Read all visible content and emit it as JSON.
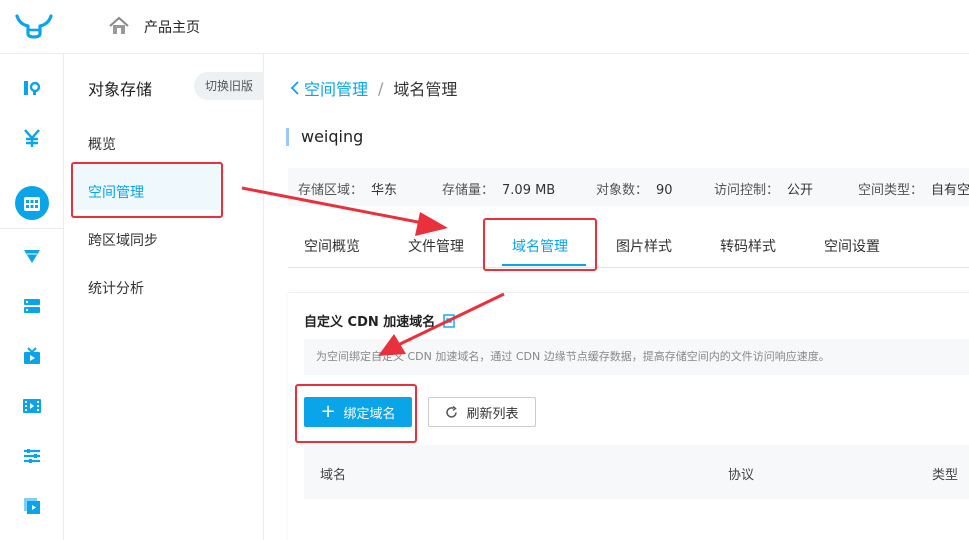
{
  "topbar": {
    "title": "产品主页"
  },
  "rail": {
    "items": [
      "stats-icon",
      "billing-icon",
      "storage-icon",
      "cdn-icon",
      "server-icon",
      "live-icon",
      "video-icon",
      "settings-icon",
      "media-icon"
    ]
  },
  "subnav": {
    "title": "对象存储",
    "switch_label": "切换旧版",
    "items": [
      {
        "label": "概览"
      },
      {
        "label": "空间管理"
      },
      {
        "label": "跨区域同步"
      },
      {
        "label": "统计分析"
      }
    ]
  },
  "breadcrumb": {
    "parent": "空间管理",
    "sep": "/",
    "current": "域名管理"
  },
  "bucket": {
    "name": "weiqing"
  },
  "info": {
    "region_label": "存储区域：",
    "region_value": "华东",
    "size_label": "存储量：",
    "size_value": "7.09 MB",
    "count_label": "对象数：",
    "count_value": "90",
    "access_label": "访问控制：",
    "access_value": "公开",
    "type_label": "空间类型：",
    "type_value": "自有空"
  },
  "tabs": [
    {
      "label": "空间概览"
    },
    {
      "label": "文件管理"
    },
    {
      "label": "域名管理"
    },
    {
      "label": "图片样式"
    },
    {
      "label": "转码样式"
    },
    {
      "label": "空间设置"
    }
  ],
  "panel": {
    "title": "自定义 CDN 加速域名",
    "tip": "为空间绑定自定义 CDN 加速域名，通过 CDN 边缘节点缓存数据，提高存储空间内的文件访问响应速度。",
    "bind_label": "绑定域名",
    "refresh_label": "刷新列表",
    "columns": [
      "域名",
      "协议",
      "类型"
    ]
  },
  "colors": {
    "accent": "#0aa5e8",
    "annotation": "#e8313c"
  }
}
